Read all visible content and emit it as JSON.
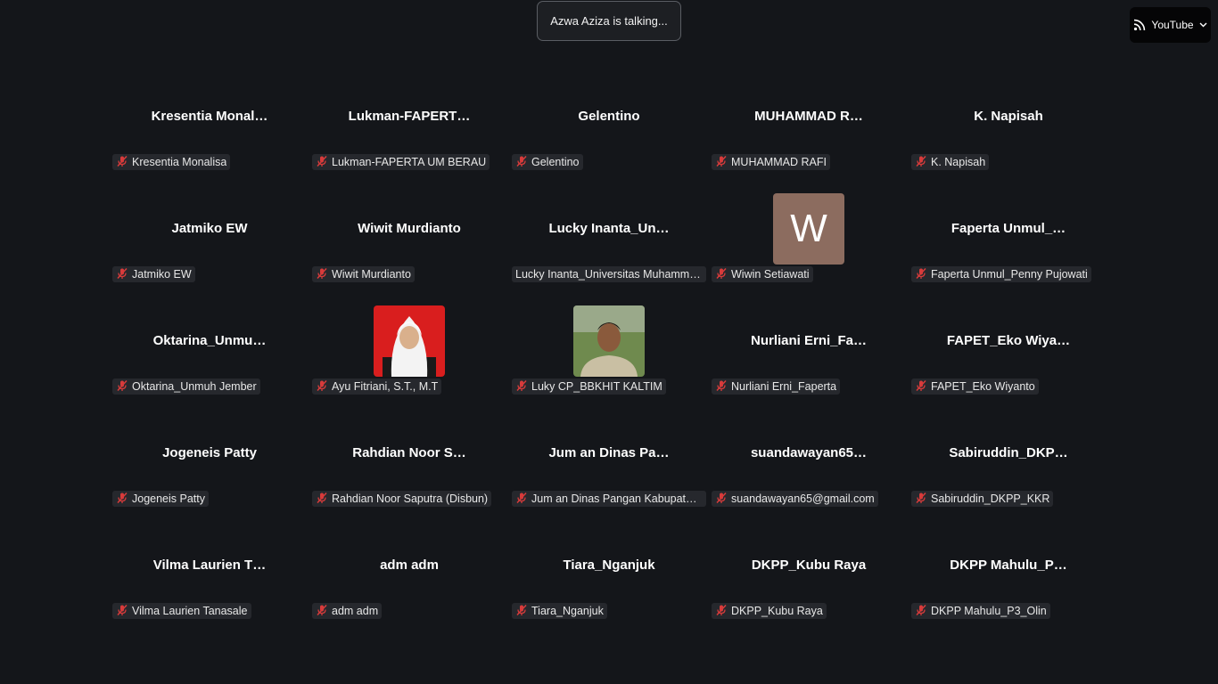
{
  "status": {
    "talking_text": "Azwa Aziza is talking..."
  },
  "stream_button": {
    "label": "YouTube",
    "icon": "live-stream-icon"
  },
  "colors": {
    "background": "#14161a",
    "muted_mic": "#d83b3b",
    "letter_avatar": "#8c6c5f"
  },
  "participants": [
    {
      "display": "Kresentia  Monal…",
      "label": "Kresentia Monalisa",
      "avatar": "none"
    },
    {
      "display": "Lukman-FAPERT…",
      "label": "Lukman-FAPERTA UM BERAU",
      "avatar": "none"
    },
    {
      "display": "Gelentino",
      "label": "Gelentino",
      "avatar": "none"
    },
    {
      "display": "MUHAMMAD  R…",
      "label": "MUHAMMAD RAFI",
      "avatar": "none"
    },
    {
      "display": "K. Napisah",
      "label": "K. Napisah",
      "avatar": "none"
    },
    {
      "display": "Jatmiko EW",
      "label": "Jatmiko EW",
      "avatar": "none"
    },
    {
      "display": "Wiwit Murdianto",
      "label": "Wiwit Murdianto",
      "avatar": "none"
    },
    {
      "display": "Lucky  Inanta_Un…",
      "label": "Lucky Inanta_Universitas Muhamma…",
      "avatar": "none",
      "no_mic": true
    },
    {
      "display": "",
      "label": "Wiwin Setiawati",
      "avatar": "letter",
      "letter": "W"
    },
    {
      "display": "Faperta  Unmul_…",
      "label": "Faperta Unmul_Penny Pujowati",
      "avatar": "none"
    },
    {
      "display": "Oktarina_Unmu…",
      "label": "Oktarina_Unmuh Jember",
      "avatar": "none"
    },
    {
      "display": "",
      "label": "Ayu Fitriani, S.T., M.T",
      "avatar": "photo-woman"
    },
    {
      "display": "",
      "label": "Luky CP_BBKHIT KALTIM",
      "avatar": "photo-man"
    },
    {
      "display": "Nurliani  Erni_Fa…",
      "label": "Nurliani Erni_Faperta",
      "avatar": "none"
    },
    {
      "display": "FAPET_Eko  Wiya…",
      "label": "FAPET_Eko Wiyanto",
      "avatar": "none"
    },
    {
      "display": "Jogeneis Patty",
      "label": "Jogeneis Patty",
      "avatar": "none"
    },
    {
      "display": "Rahdian  Noor  S…",
      "label": "Rahdian Noor Saputra (Disbun)",
      "avatar": "none"
    },
    {
      "display": "Jum an Dinas Pa…",
      "label": "Jum an Dinas Pangan Kabupate…",
      "avatar": "none"
    },
    {
      "display": "suandawayan65…",
      "label": "suandawayan65@gmail.com",
      "avatar": "none"
    },
    {
      "display": "Sabiruddin_DKP…",
      "label": "Sabiruddin_DKPP_KKR",
      "avatar": "none"
    },
    {
      "display": "Vilma Laurien T…",
      "label": "Vilma Laurien Tanasale",
      "avatar": "none"
    },
    {
      "display": "adm adm",
      "label": "adm adm",
      "avatar": "none"
    },
    {
      "display": "Tiara_Nganjuk",
      "label": "Tiara_Nganjuk",
      "avatar": "none"
    },
    {
      "display": "DKPP_Kubu Raya",
      "label": "DKPP_Kubu Raya",
      "avatar": "none"
    },
    {
      "display": "DKPP  Mahulu_P…",
      "label": "DKPP Mahulu_P3_Olin",
      "avatar": "none"
    }
  ]
}
